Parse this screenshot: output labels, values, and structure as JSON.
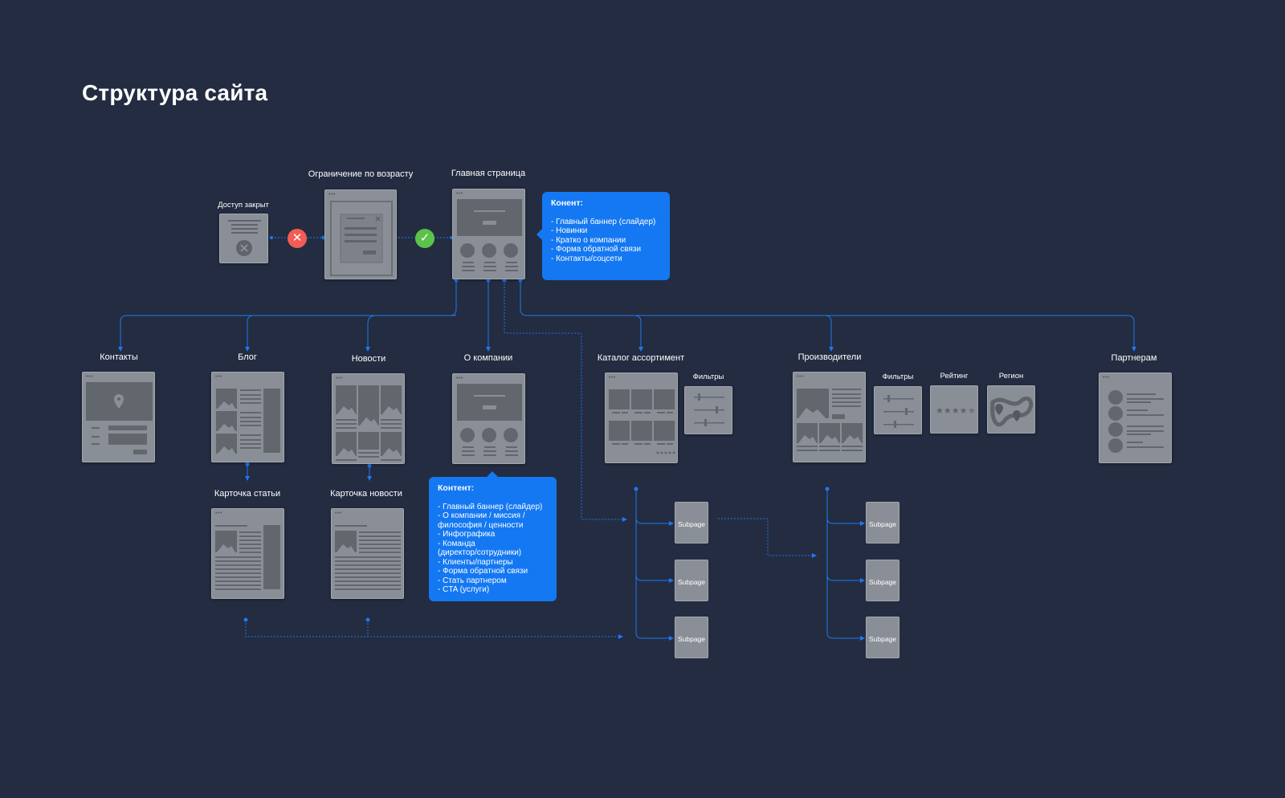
{
  "title": "Структура сайта",
  "pages": {
    "access_denied": "Доступ закрыт",
    "age_gate": "Ограничение по возрасту",
    "home": "Главная страница",
    "contacts": "Контакты",
    "blog": "Блог",
    "news": "Новости",
    "about": "О компании",
    "catalog": "Каталог ассортимент",
    "manufacturers": "Производители",
    "partners": "Партнерам",
    "article_card": "Карточка статьи",
    "news_card": "Карточка новости"
  },
  "widgets": {
    "catalog_filters": "Фильтры",
    "manuf_filters": "Фильтры",
    "rating": "Рейтинг",
    "region": "Регион"
  },
  "subpage_label": "Subpage",
  "home_note": {
    "heading": "Конент:",
    "items": [
      "- Главный баннер (слайдер)",
      "- Новинки",
      "- Кратко о компании",
      "- Форма обратной связи",
      "- Контакты/соцсети"
    ]
  },
  "about_note": {
    "heading": "Контент:",
    "items": [
      "- Главный баннер (слайдер)",
      "- О компании / миссия /",
      "философия / ценности",
      "- Инфографика",
      "- Команда",
      "(директор/сотрудники)",
      "-  Клиенты/партнеры",
      "- Форма обратной связи",
      "- Стать партнером",
      "- CTA (услуги)"
    ]
  },
  "colors": {
    "background": "#232c41",
    "accent": "#1478f2",
    "reject": "#f25c54",
    "accept": "#5cc34a",
    "wireframe": "#8a8e96"
  },
  "icons": {
    "reject": "close-icon",
    "accept": "check-icon"
  }
}
